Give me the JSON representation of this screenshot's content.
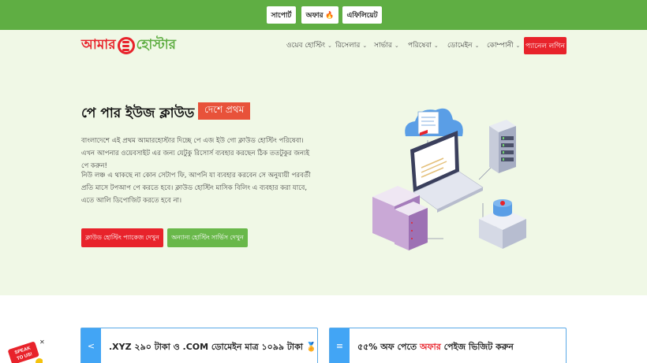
{
  "topbar": {
    "support": "সাপোর্ট",
    "offer": "অফার 🔥",
    "affiliate": "এফিলিয়েট"
  },
  "logo": {
    "part1": "আমার",
    "part2": "হোস্টার"
  },
  "nav": {
    "items": [
      {
        "label": "ওয়েব হোস্টিং"
      },
      {
        "label": "রিসেলার"
      },
      {
        "label": "সার্ভার"
      },
      {
        "label": "পরিষেবা"
      },
      {
        "label": "ডোমেইন"
      },
      {
        "label": "কোম্পানী"
      }
    ],
    "login": "প্যানেল লগিন"
  },
  "hero": {
    "title": "পে পার ইউজ ক্লাউড",
    "badge": "দেশে প্রথম",
    "p1": "বাংলাদেশে এই প্রথম আমারহোস্টার দিচ্ছে পে এজ ইউ গো ক্লাউড হোস্টিং পরিষেবা। এখন আপনার ওয়েবসাইট এর জন্য যেটুকু রিসোর্স ব্যবহার করছেন ঠিক ততটুকুর জন্যই পে করুন!",
    "p2": "নিউ লঞ্চ এ থাকছে না কোন সেটাপ ফি, আপনি যা ব্যবহার করবেন সে অনুযায়ী পরবর্তী প্রতি মাসে টপআপ পে করতে হবে। ক্লাউড হোস্টিং মাসিক বিলিং এ ব্যবহার করা যাবে, এতে আলি ডিপোজিট করতে হবে না।",
    "btn_cloud": "ক্লাউড হোস্টিং প্যাকেজ দেখুন",
    "btn_other": "অন্যান্য হোস্টিং সার্ভিস দেখুন"
  },
  "cards": [
    {
      "icon": "share-icon",
      "text": ".XYZ ২৯০ টাকা ও .COM ডোমেইন মাত্র ১০৯৯ টাকা 🏅"
    },
    {
      "icon": "layers-icon",
      "text_before": "৫৫% অফ পেতে ",
      "text_accent": "অফার",
      "text_after": " পেইজ ভিজিট করুন"
    }
  ],
  "speak": {
    "label1": "SPEAK",
    "label2": "TO US!"
  },
  "colors": {
    "green": "#5fae43",
    "red": "#e8232b",
    "blue": "#42a5f5",
    "hero_bg": "#f0f8e6"
  }
}
